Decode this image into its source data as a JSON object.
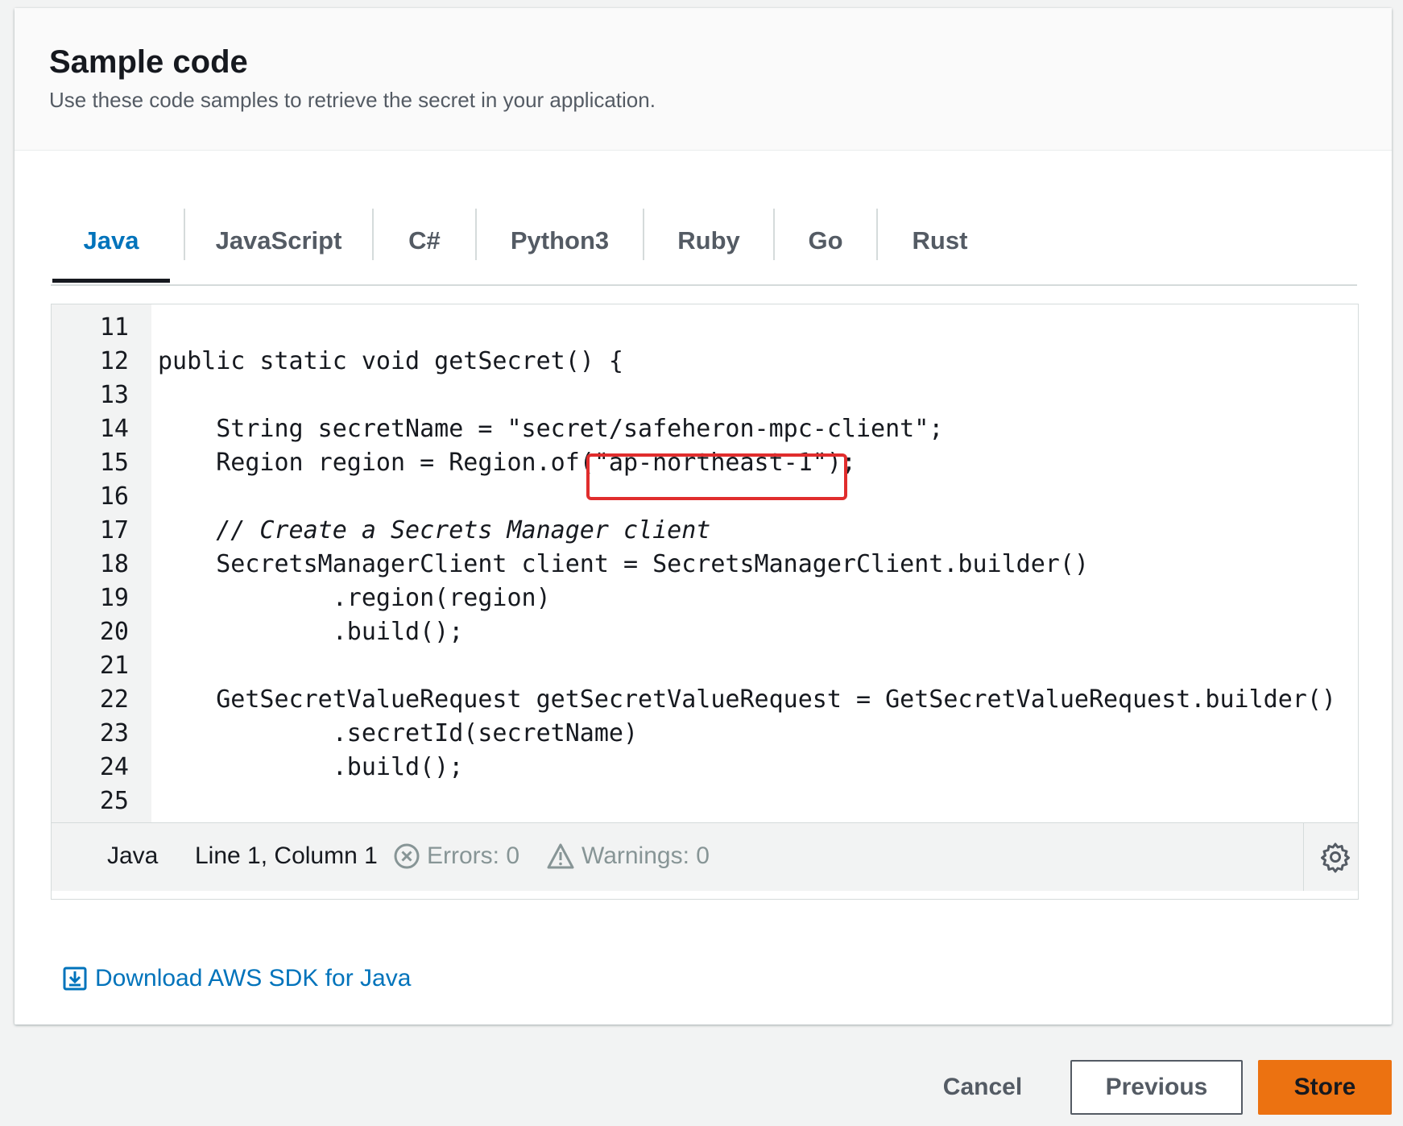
{
  "panel": {
    "title": "Sample code",
    "description": "Use these code samples to retrieve the secret in your application."
  },
  "tabs": [
    {
      "label": "Java",
      "active": true
    },
    {
      "label": "JavaScript",
      "active": false
    },
    {
      "label": "C#",
      "active": false
    },
    {
      "label": "Python3",
      "active": false
    },
    {
      "label": "Ruby",
      "active": false
    },
    {
      "label": "Go",
      "active": false
    },
    {
      "label": "Rust",
      "active": false
    }
  ],
  "editor": {
    "lines": [
      {
        "n": "11",
        "text": ""
      },
      {
        "n": "12",
        "text": "public static void getSecret() {"
      },
      {
        "n": "13",
        "text": ""
      },
      {
        "n": "14",
        "text": "    String secretName = \"secret/safeheron-mpc-client\";"
      },
      {
        "n": "15",
        "text": "    Region region = Region.of(\"ap-northeast-1\");"
      },
      {
        "n": "16",
        "text": ""
      },
      {
        "n": "17",
        "text": "    // Create a Secrets Manager client",
        "comment": true
      },
      {
        "n": "18",
        "text": "    SecretsManagerClient client = SecretsManagerClient.builder()"
      },
      {
        "n": "19",
        "text": "            .region(region)"
      },
      {
        "n": "20",
        "text": "            .build();"
      },
      {
        "n": "21",
        "text": ""
      },
      {
        "n": "22",
        "text": "    GetSecretValueRequest getSecretValueRequest = GetSecretValueRequest.builder()"
      },
      {
        "n": "23",
        "text": "            .secretId(secretName)"
      },
      {
        "n": "24",
        "text": "            .build();"
      },
      {
        "n": "25",
        "text": ""
      }
    ],
    "status": {
      "language": "Java",
      "position": "Line 1, Column 1",
      "errors": "Errors: 0",
      "warnings": "Warnings: 0"
    }
  },
  "download_link": "Download AWS SDK for Java",
  "buttons": {
    "cancel": "Cancel",
    "previous": "Previous",
    "store": "Store"
  },
  "colors": {
    "accent": "#0073bb",
    "primary_button": "#ec7211",
    "highlight": "#e02d2d"
  }
}
